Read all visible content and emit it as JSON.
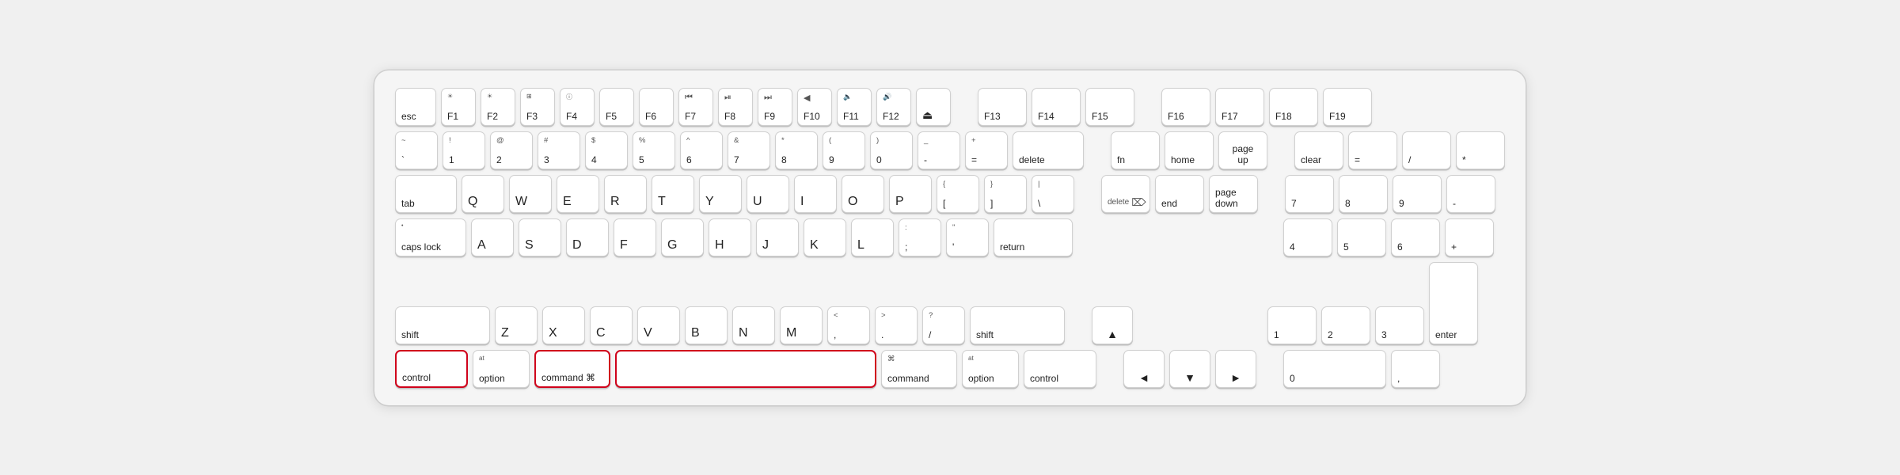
{
  "keyboard": {
    "rows": {
      "fn_row": [
        "esc",
        "F1",
        "F2",
        "F3",
        "F4",
        "F5",
        "F6",
        "F7",
        "F8",
        "F9",
        "F10",
        "F11",
        "F12",
        "",
        "F13",
        "F14",
        "F15",
        "",
        "F16",
        "F17",
        "F18",
        "F19"
      ],
      "number_row": [
        "~`",
        "!1",
        "@2",
        "#3",
        "$4",
        "%5",
        "^6",
        "&7",
        "*8",
        "(9",
        ")0",
        "-",
        "+=",
        "delete",
        "fn",
        "home",
        "page up",
        "clear",
        "=",
        "/",
        "*"
      ],
      "tab_row": [
        "tab",
        "Q",
        "W",
        "E",
        "R",
        "T",
        "Y",
        "U",
        "I",
        "O",
        "P",
        "{[",
        "}]",
        "|\\",
        "delete⌫",
        "end",
        "page down",
        "7",
        "8",
        "9",
        "-"
      ],
      "caps_row": [
        "caps lock",
        "A",
        "S",
        "D",
        "F",
        "G",
        "H",
        "J",
        "K",
        "L",
        ";:",
        "'\"",
        "return",
        "4",
        "5",
        "6",
        "+"
      ],
      "shift_row": [
        "shift",
        "Z",
        "X",
        "C",
        "V",
        "B",
        "N",
        "M",
        "<,",
        ">.",
        "?/",
        "shift",
        "▲",
        "1",
        "2",
        "3"
      ],
      "bottom_row": [
        "control",
        "option",
        "command",
        "space",
        "command",
        "option",
        "control",
        "◄",
        "▼",
        "►",
        "0",
        ",",
        "enter"
      ]
    }
  }
}
